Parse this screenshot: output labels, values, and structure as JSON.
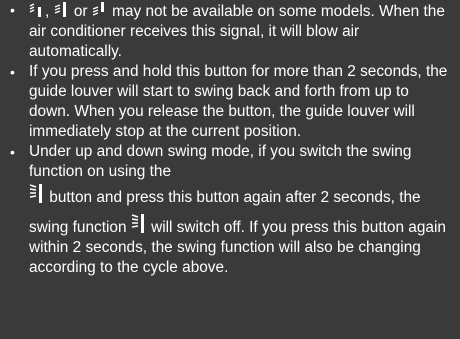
{
  "notes": {
    "bullet": "•",
    "item1": {
      "sep1": ",",
      "sep2": " or ",
      "text": " may not be available on some models. When the air conditioner receives this signal, it will blow air automatically.",
      "icons": [
        "louver-swing-icon-a",
        "louver-swing-icon-b",
        "louver-swing-icon-c"
      ]
    },
    "item2": {
      "text": "If you press and hold this button for more than 2 seconds, the guide louver will start to swing back and forth from up to down. When you release the button, the guide louver will immediately stop at the current position."
    },
    "item3": {
      "text_before": "Under up and down swing mode, if you switch the swing function on using the",
      "text_middle": " button and press this button again after 2 seconds, the swing function",
      "text_after": " will switch off. If you press this button again within 2 seconds, the swing function will also be changing according to the cycle above.",
      "icons": [
        "swing-button-icon",
        "swing-button-icon"
      ]
    }
  }
}
